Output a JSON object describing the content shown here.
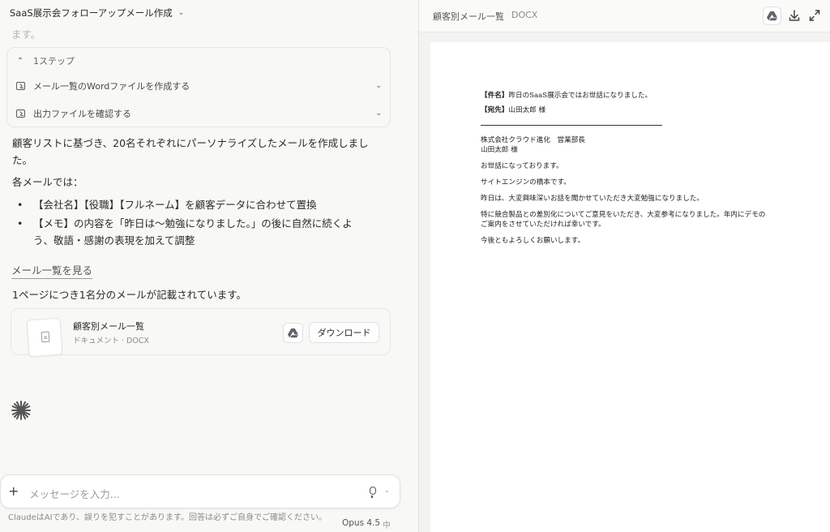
{
  "chat": {
    "title": "SaaS展示会フォローアップメール作成",
    "faded_text": "ます。",
    "steps": {
      "header": "1ステップ",
      "items": [
        {
          "label": "メール一覧のWordファイルを作成する"
        },
        {
          "label": "出力ファイルを確認する"
        }
      ]
    },
    "body": "顧客リストに基づき、20名それぞれにパーソナライズしたメールを作成しました。",
    "sub": "各メールでは：",
    "bullets": [
      "【会社名】【役職】【フルネーム】を顧客データに合わせて置換",
      "【メモ】の内容を「昨日は〜勉強になりました。」の後に自然に続くよう、敬語・感謝の表現を加えて調整"
    ],
    "view_link": "メール一覧を見る",
    "page_note": "1ページにつき1名分のメールが記載されています。",
    "file": {
      "name": "顧客別メール一覧",
      "meta": "ドキュメント · DOCX",
      "download_label": "ダウンロード"
    },
    "input_placeholder": "メッセージを入力...",
    "disclaimer": "ClaudeはAIであり、誤りを犯すことがあります。回答は必ずご自身でご確認ください。",
    "model": "Opus 4.5",
    "model_sub": "中"
  },
  "preview": {
    "title": "顧客別メール一覧",
    "type": "DOCX",
    "doc": {
      "subject_label": "【件名】",
      "subject": "昨日のSaaS展示会ではお世話になりました。",
      "to_label": "【宛先】",
      "to": "山田太郎 様",
      "company_line": "株式会社クラウド進化　営業部長",
      "name_line": "山田太郎 様",
      "p1": "お世話になっております。",
      "p2": "サイトエンジンの橋本です。",
      "p3": "昨日は、大変興味深いお話を聞かせていただき大変勉強になりました。",
      "p4a": "特に競合製品との差別化についてご意見をいただき、大変参考になりました。年内にデモの",
      "p4b": "ご案内をさせていただければ幸いです。",
      "p5": "今後ともよろしくお願いします。"
    }
  },
  "colors": {
    "background": "#f8f8f6",
    "accent_spark": "#555555"
  }
}
